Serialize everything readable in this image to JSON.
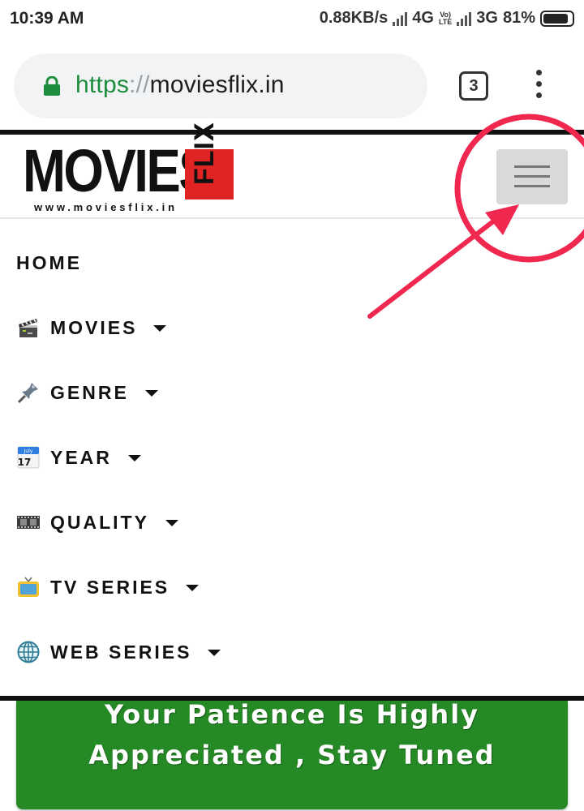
{
  "status_bar": {
    "time": "10:39 AM",
    "speed": "0.88KB/s",
    "network_1": "4G",
    "volte_top": "Vo)",
    "volte_bottom": "LTE",
    "network_2": "3G",
    "battery": "81%"
  },
  "browser": {
    "url_scheme": "https",
    "url_sep": "://",
    "url_host": "moviesflix.in",
    "tab_count": "3",
    "icons": [
      "lock-icon",
      "tabs-switcher-icon",
      "more-vertical-icon"
    ],
    "lock_color": "#1e8e3e"
  },
  "site": {
    "logo_main": "MOVIES",
    "logo_flix": "FLIX",
    "logo_url": "www.moviesflix.in",
    "logo_red": "#e02424"
  },
  "nav": {
    "items": [
      {
        "label": "HOME",
        "icon": null,
        "has_dropdown": false
      },
      {
        "label": "MOVIES",
        "icon": "clapperboard-icon",
        "has_dropdown": true
      },
      {
        "label": "GENRE",
        "icon": "pushpin-icon",
        "has_dropdown": true
      },
      {
        "label": "YEAR",
        "icon": "calendar-icon",
        "has_dropdown": true
      },
      {
        "label": "QUALITY",
        "icon": "film-strip-icon",
        "has_dropdown": true
      },
      {
        "label": "TV SERIES",
        "icon": "television-icon",
        "has_dropdown": true
      },
      {
        "label": "WEB SERIES",
        "icon": "globe-icon",
        "has_dropdown": true
      }
    ],
    "calendar_month": "July",
    "calendar_day": "17"
  },
  "banner": {
    "line1": "Your Patience Is Highly",
    "line2": "Appreciated , Stay Tuned",
    "color": "#258a25"
  },
  "annotation_color": "#f0284f"
}
